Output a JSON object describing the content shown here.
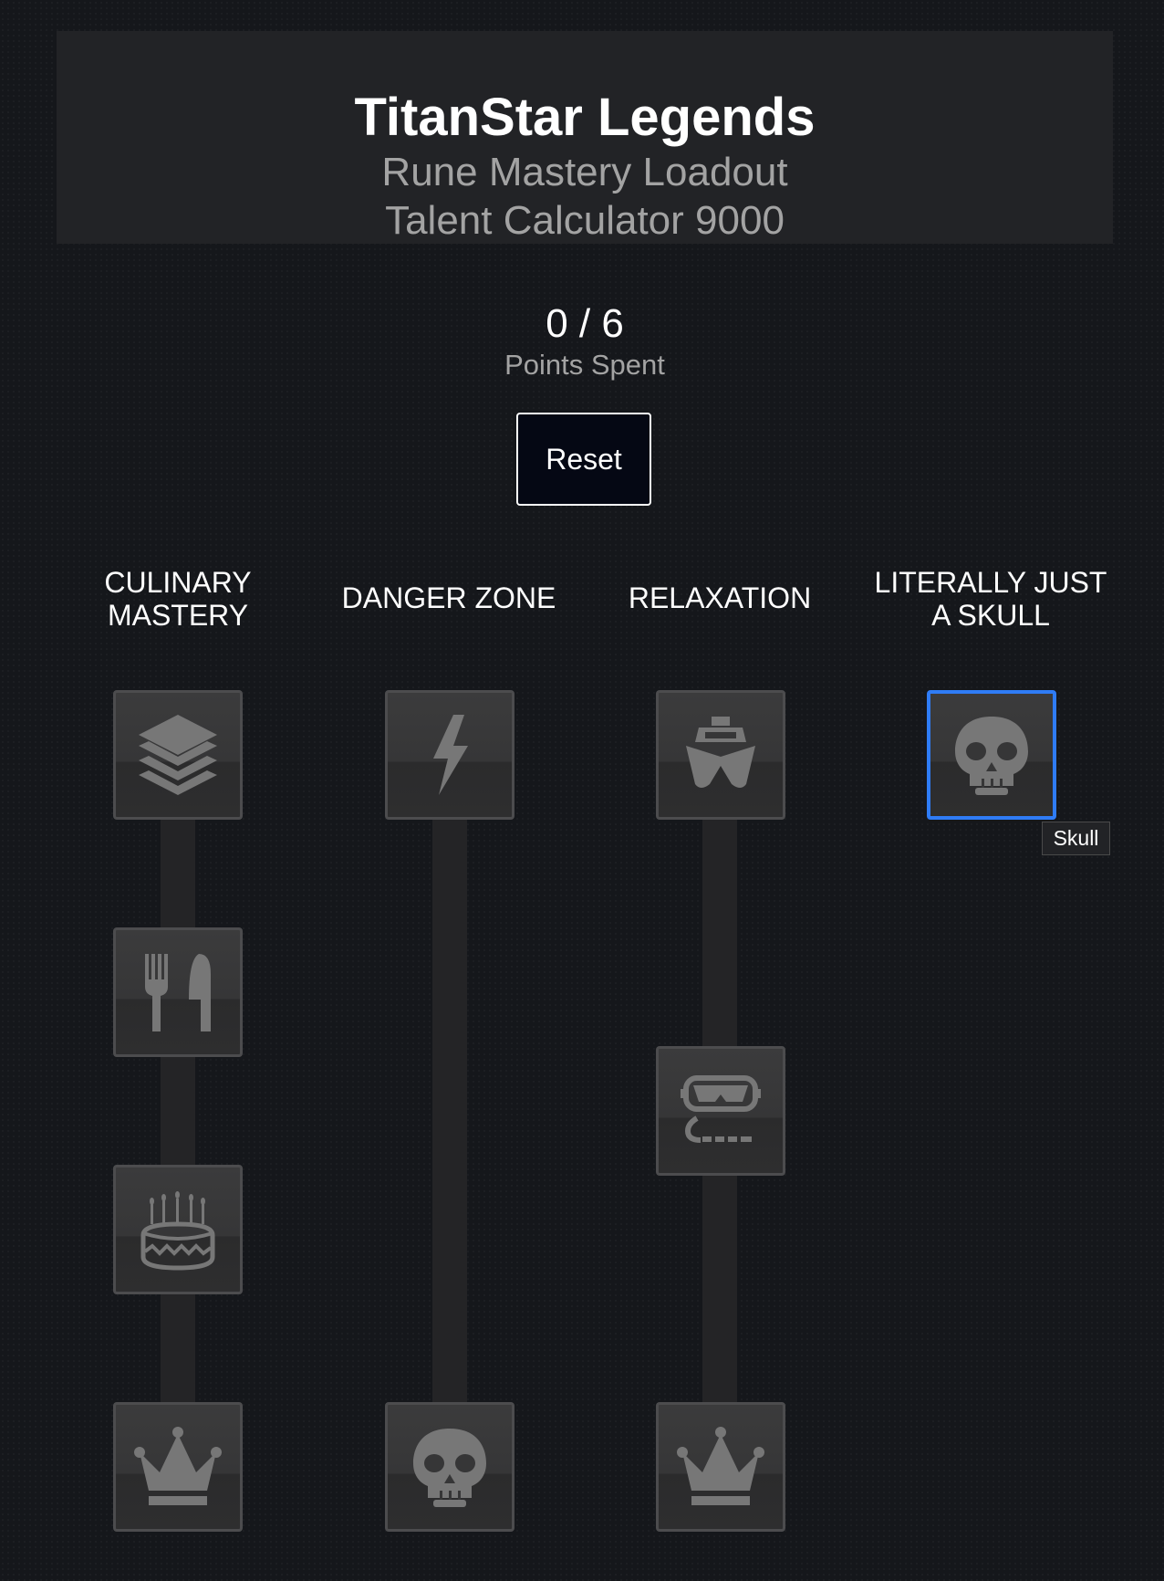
{
  "header": {
    "title": "TitanStar Legends",
    "subtitle": "Rune Mastery Loadout",
    "subtitle2": "Talent Calculator 9000"
  },
  "points": {
    "value": "0 / 6",
    "label": "Points Spent"
  },
  "reset_label": "Reset",
  "columns": [
    {
      "title": "CULINARY MASTERY",
      "title_lines": [
        "CULINARY",
        "MASTERY"
      ],
      "talents": [
        "stack-icon",
        "fork-knife-icon",
        "cake-icon",
        "crown-icon"
      ]
    },
    {
      "title": "DANGER ZONE",
      "title_lines": [
        "DANGER ZONE"
      ],
      "talents": [
        "lightning-icon",
        "skull-icon"
      ]
    },
    {
      "title": "RELAXATION",
      "title_lines": [
        "RELAXATION"
      ],
      "talents": [
        "boat-icon",
        "snorkel-icon",
        "crown-icon"
      ]
    },
    {
      "title": "LITERALLY JUST A SKULL",
      "title_lines": [
        "LITERALLY JUST",
        "A SKULL"
      ],
      "talents": [
        "skull-icon"
      ]
    }
  ],
  "tooltip": "Skull",
  "colors": {
    "icon": "#777777",
    "tile_border": "#4c4c4e",
    "selected_border": "#2f7cf6",
    "background": "#15171b",
    "header_bg": "#222326",
    "reset_bg": "#050814"
  }
}
